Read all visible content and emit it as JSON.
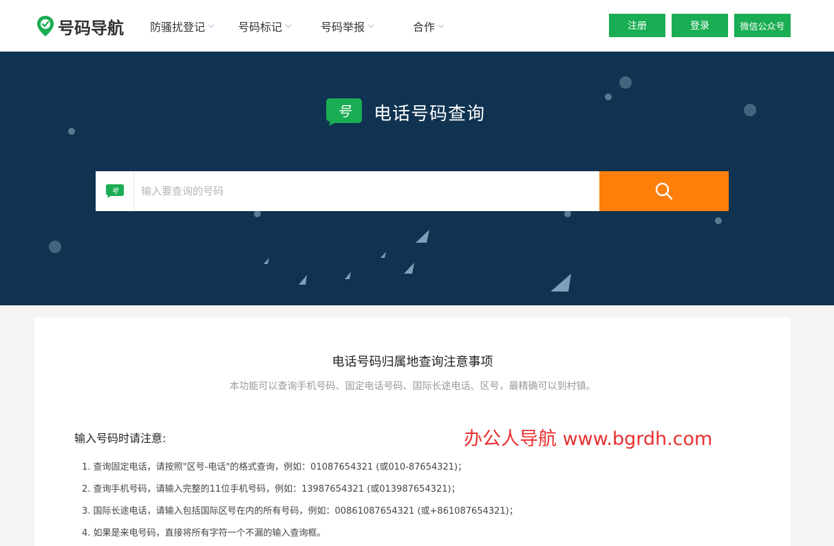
{
  "header": {
    "logo_text": "号码导航",
    "nav": [
      {
        "label": "防骚扰登记"
      },
      {
        "label": "号码标记"
      },
      {
        "label": "号码举报"
      },
      {
        "label": "合作"
      }
    ],
    "register_label": "注册",
    "login_label": "登录",
    "wechat_label": "微信公众号"
  },
  "hero": {
    "badge_char": "号",
    "title": "电话号码查询",
    "search": {
      "prefix_char": "号",
      "placeholder": "输入要查询的号码",
      "value": ""
    }
  },
  "content": {
    "title": "电话号码归属地查询注意事项",
    "subtitle": "本功能可以查询手机号码、固定电话号码、国际长途电话、区号，最精确可以到村镇。",
    "section_title": "输入号码时请注意:",
    "watermark": "办公人导航 www.bgrdh.com",
    "tips": [
      "1. 查询固定电话，请按照\"区号-电话\"的格式查询，例如：01087654321 (或010-87654321)；",
      "2. 查询手机号码，请输入完整的11位手机号码，例如：13987654321 (或013987654321)；",
      "3. 国际长途电话，请输入包括国际区号在内的所有号码，例如：00861087654321 (或+861087654321)；",
      "4. 如果是来电号码，直接将所有字符一个不漏的输入查询框。"
    ]
  },
  "colors": {
    "brand_green": "#1aad53",
    "search_orange": "#ff7f0b",
    "hero_bg": "#0f3350",
    "watermark_red": "#e8302f"
  },
  "icons": {
    "logo": "location-pin-check-icon",
    "nav_chevron": "chevron-down-icon",
    "search": "magnifier-icon",
    "badge": "speech-bubble-icon"
  }
}
